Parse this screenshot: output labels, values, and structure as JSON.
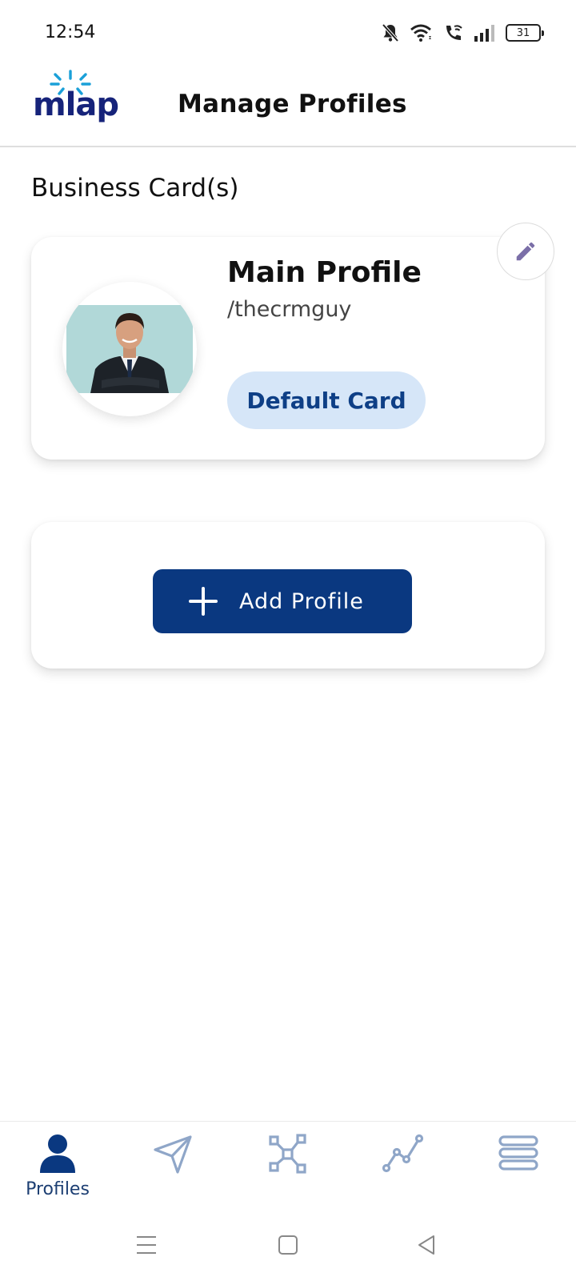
{
  "status_bar": {
    "time": "12:54",
    "battery": "31"
  },
  "header": {
    "logo_text": "mlap",
    "title": "Manage Profiles"
  },
  "section": {
    "title": "Business Card(s)"
  },
  "profile_card": {
    "name": "Main Profile",
    "handle": "/thecrmguy",
    "badge_label": "Default Card",
    "edit_icon": "pencil-icon"
  },
  "add_profile": {
    "label": "Add Profile",
    "icon": "plus-icon"
  },
  "bottom_nav": {
    "items": [
      {
        "label": "Profiles",
        "icon": "person-icon",
        "active": true
      },
      {
        "label": "",
        "icon": "send-icon",
        "active": false
      },
      {
        "label": "",
        "icon": "network-icon",
        "active": false
      },
      {
        "label": "",
        "icon": "analytics-icon",
        "active": false
      },
      {
        "label": "",
        "icon": "menu-icon",
        "active": false
      }
    ]
  },
  "colors": {
    "primary": "#0a3880",
    "badge_bg": "#d6e6f8",
    "badge_text": "#0e3f86",
    "nav_active": "#1d3f73",
    "nav_inactive": "#8fa6c8",
    "edit_icon": "#7b6fa8"
  }
}
